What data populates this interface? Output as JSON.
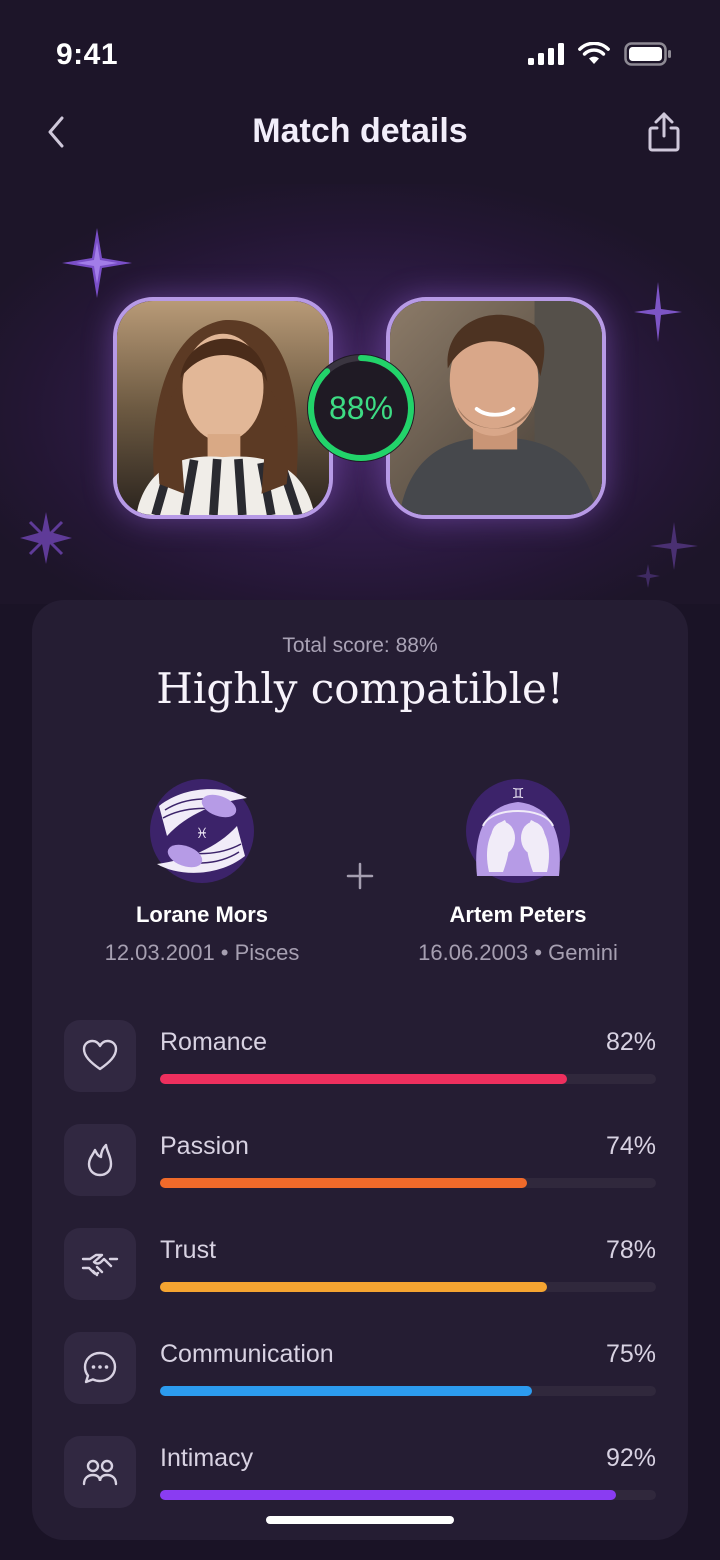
{
  "status_bar": {
    "time": "9:41"
  },
  "navbar": {
    "title": "Match details"
  },
  "hero": {
    "score_label": "88%",
    "score_fraction": 0.88,
    "ring_color": "#22d36a"
  },
  "summary": {
    "total_score": "Total score: 88%",
    "headline": "Highly compatible!"
  },
  "people": [
    {
      "name": "Lorane Mors",
      "info": "12.03.2001 • Pisces",
      "sign": "pisces-icon"
    },
    {
      "name": "Artem Peters",
      "info": "16.06.2003 • Gemini",
      "sign": "gemini-icon"
    }
  ],
  "metrics": [
    {
      "label": "Romance",
      "value": "82%",
      "fraction": 0.82,
      "color": "#ee2f5e",
      "icon": "heart-icon"
    },
    {
      "label": "Passion",
      "value": "74%",
      "fraction": 0.74,
      "color": "#f06a2a",
      "icon": "flame-icon"
    },
    {
      "label": "Trust",
      "value": "78%",
      "fraction": 0.78,
      "color": "#f5a431",
      "icon": "handshake-icon"
    },
    {
      "label": "Communication",
      "value": "75%",
      "fraction": 0.75,
      "color": "#2c9bef",
      "icon": "chat-icon"
    },
    {
      "label": "Intimacy",
      "value": "92%",
      "fraction": 0.92,
      "color": "#8a3cf2",
      "icon": "people-icon"
    }
  ]
}
